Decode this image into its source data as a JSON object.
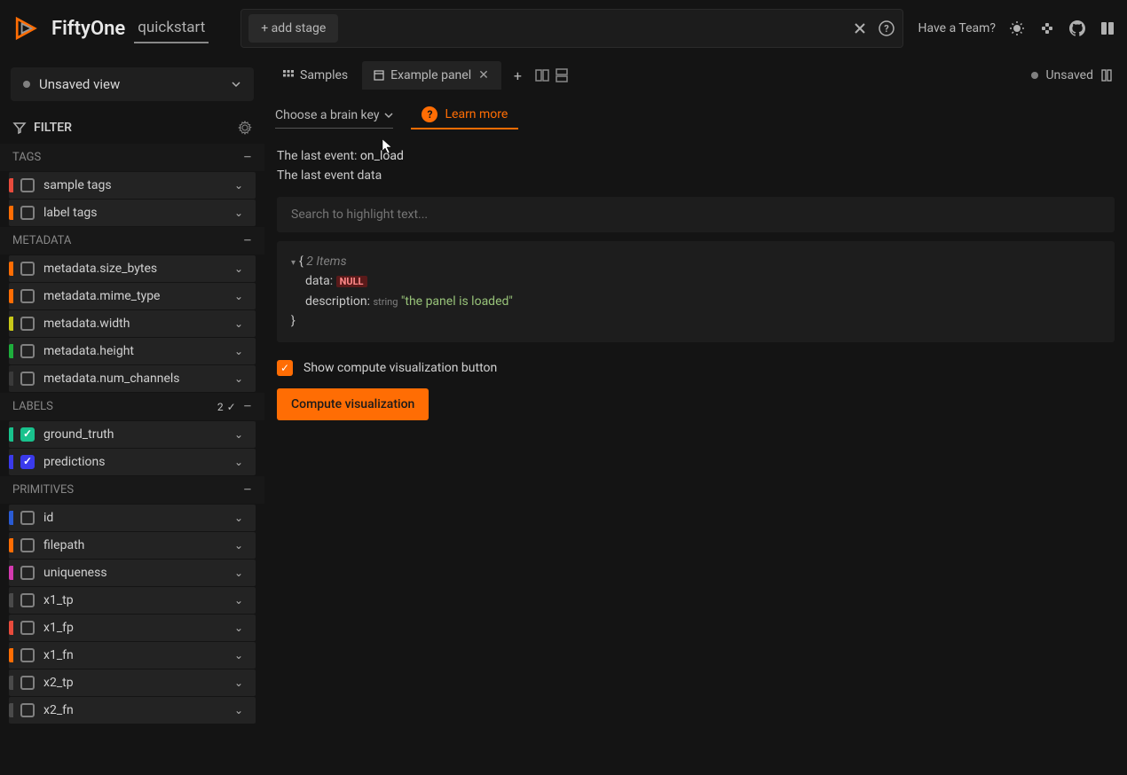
{
  "header": {
    "brand": "FiftyOne",
    "dataset": "quickstart",
    "add_stage": "+ add stage",
    "team_prompt": "Have a Team?"
  },
  "view_selector": {
    "label": "Unsaved view"
  },
  "filter": {
    "title": "FILTER"
  },
  "sidebar": {
    "groups": [
      {
        "name": "TAGS",
        "items": [
          {
            "label": "sample tags",
            "color": "#e84b3c"
          },
          {
            "label": "label tags",
            "color": "#ff6d04"
          }
        ]
      },
      {
        "name": "METADATA",
        "items": [
          {
            "label": "metadata.size_bytes",
            "color": "#ff6d04"
          },
          {
            "label": "metadata.mime_type",
            "color": "#ff6d04"
          },
          {
            "label": "metadata.width",
            "color": "#c8c819"
          },
          {
            "label": "metadata.height",
            "color": "#1eae3c"
          },
          {
            "label": "metadata.num_channels",
            "color": "#3a3a3a"
          }
        ]
      },
      {
        "name": "LABELS",
        "count": "2",
        "checked": true,
        "items": [
          {
            "label": "ground_truth",
            "color": "#19c28d",
            "checked": "orange"
          },
          {
            "label": "predictions",
            "color": "#3a3aeb",
            "checked": "blue"
          }
        ]
      },
      {
        "name": "PRIMITIVES",
        "items": [
          {
            "label": "id",
            "color": "#2a5bd4"
          },
          {
            "label": "filepath",
            "color": "#ff6d04"
          },
          {
            "label": "uniqueness",
            "color": "#d43ab0"
          },
          {
            "label": "x1_tp",
            "color": "#4a4a4a"
          },
          {
            "label": "x1_fp",
            "color": "#e84b3c"
          },
          {
            "label": "x1_fn",
            "color": "#ff6d04"
          },
          {
            "label": "x2_tp",
            "color": "#4a4a4a"
          },
          {
            "label": "x2_fn",
            "color": "#4a4a4a"
          }
        ]
      }
    ]
  },
  "tabs": {
    "samples": "Samples",
    "example": "Example panel",
    "unsaved": "Unsaved"
  },
  "panel": {
    "brain_key": "Choose a brain key",
    "learn_more": "Learn more",
    "last_event_label": "The last event:",
    "last_event_value": "on_load",
    "last_event_data_label": "The last event data",
    "search_placeholder": "Search to highlight text...",
    "json": {
      "count": "2 Items",
      "k_data": "data:",
      "v_null": "NULL",
      "k_desc": "description:",
      "t_string": "string",
      "v_desc": "\"the panel is loaded\""
    },
    "show_viz_label": "Show compute visualization button",
    "compute_btn": "Compute visualization"
  }
}
